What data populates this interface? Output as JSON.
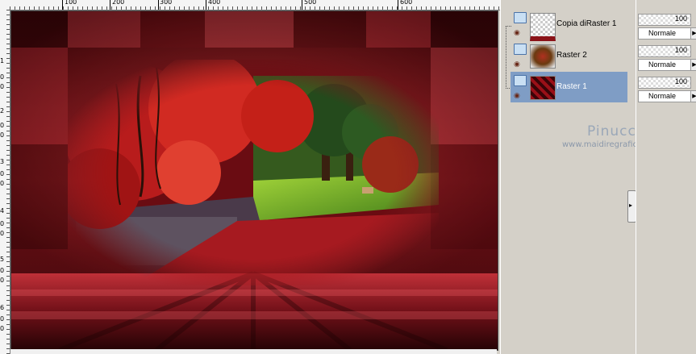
{
  "ruler": {
    "top_labels": [
      "100",
      "200",
      "300",
      "400",
      "500",
      "600"
    ],
    "left_labels": [
      "1",
      "0",
      "0",
      "2",
      "0",
      "0",
      "3",
      "0",
      "0",
      "4",
      "0",
      "0",
      "5",
      "0",
      "0",
      "6",
      "0",
      "0"
    ]
  },
  "layers": [
    {
      "name": "Copia diRaster 1",
      "selected": false
    },
    {
      "name": "Raster 2",
      "selected": false
    },
    {
      "name": "Raster 1",
      "selected": true
    }
  ],
  "props": [
    {
      "opacity": "100",
      "blend": "Normale"
    },
    {
      "opacity": "100",
      "blend": "Normale"
    },
    {
      "opacity": "100",
      "blend": "Normale"
    }
  ],
  "watermark": {
    "name": "Pinuccia",
    "site": "www.maidiregrafica.eu"
  },
  "colors": {
    "selected": "#7f9dc5",
    "canvas_base": "#7a0a14",
    "accent_red": "#e84545"
  },
  "icons": {
    "layer_group": "layer-group-icon",
    "visibility": "eye-icon"
  }
}
